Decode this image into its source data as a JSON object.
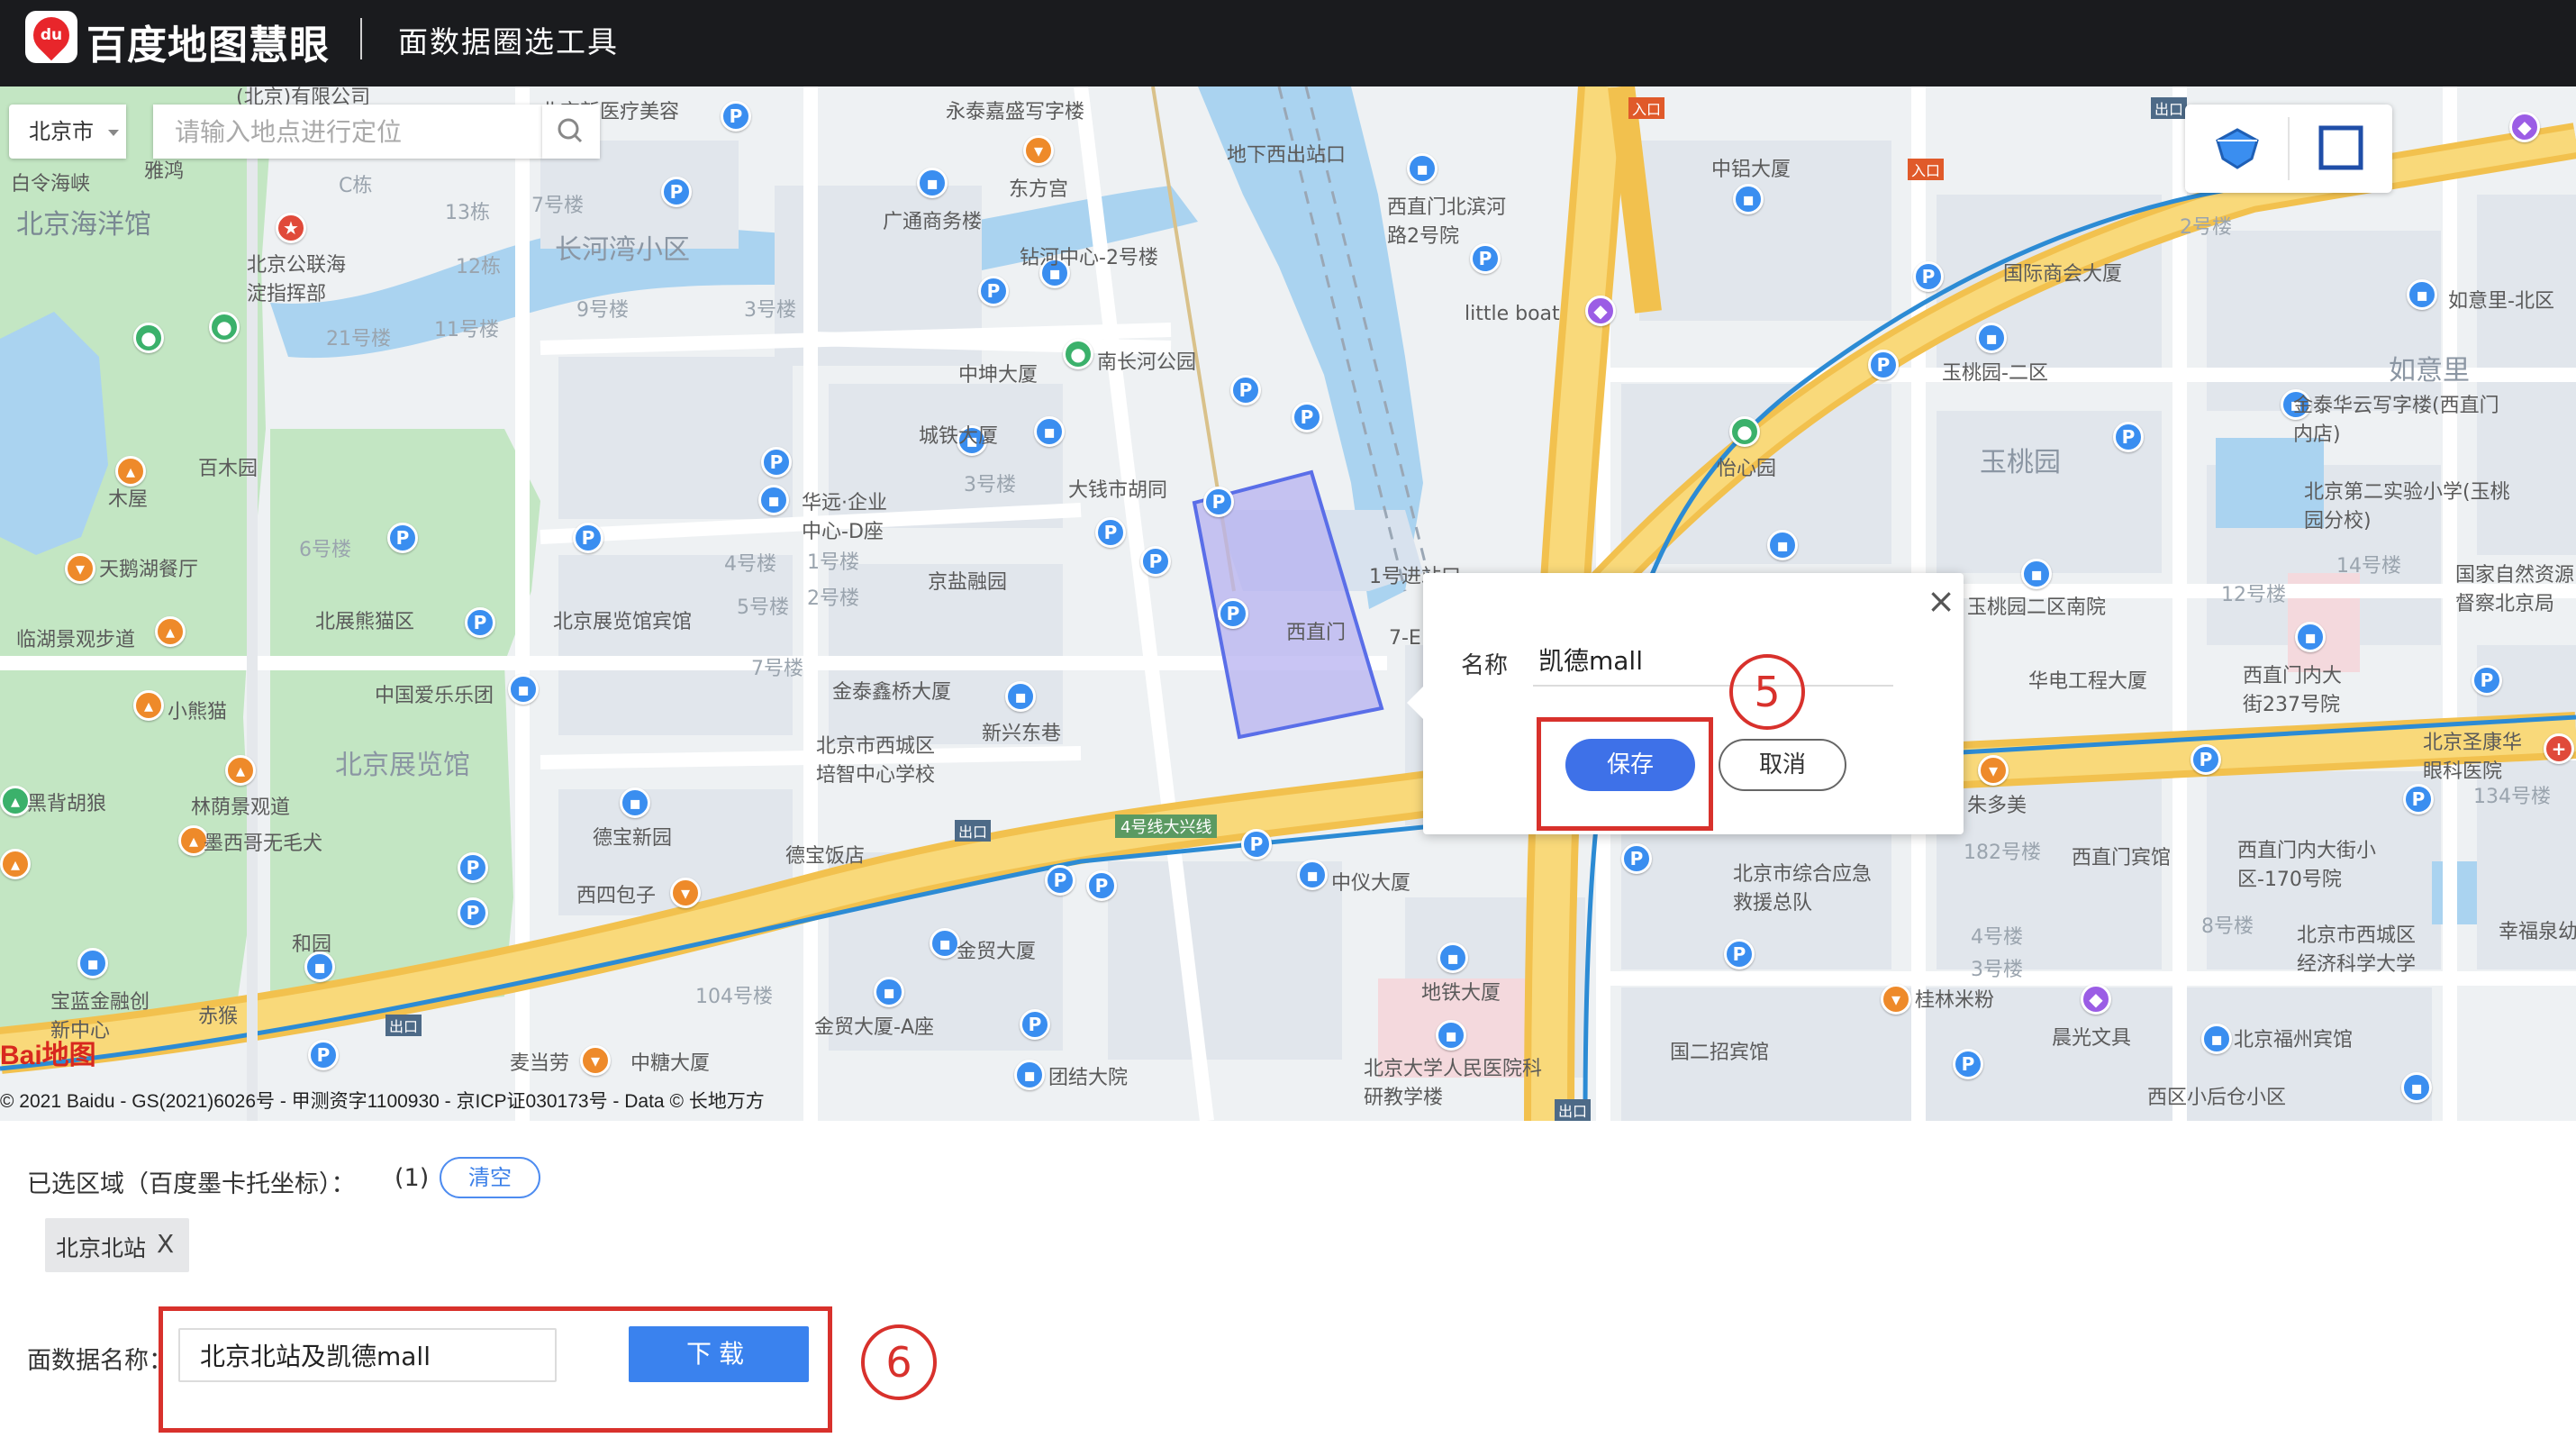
{
  "header": {
    "logo_text": "du",
    "brand": "百度地图慧眼",
    "tool_title": "面数据圈选工具",
    "bg_color": "#1a1b1e"
  },
  "map": {
    "city_select": "北京市",
    "search_placeholder": "请输入地点进行定位",
    "attribution": "© 2021 Baidu - GS(2021)6026号 - 甲测资字1100930 - 京ICP证030173号 - Data © 长地万方",
    "baidu_logo": "Bai地图",
    "labels": {
      "a1": "(北京)有限公司",
      "a2": "北京新医疗美容",
      "a3": "永泰嘉盛写字楼",
      "a4": "地下西出站口",
      "a5": "西直门北滨河路2号院",
      "a6": "中铝大厦",
      "a7": "白令海峡",
      "a8": "雅鸿",
      "a9": "北京海洋馆",
      "a10": "C栋",
      "a11": "13栋",
      "a12": "7号楼",
      "a13": "广通商务楼",
      "a14": "东方宫",
      "a15": "长河湾小区",
      "a16": "钻河中心-2号楼",
      "a17": "北京公联海淀指挥部",
      "a18": "12栋",
      "a19": "9号楼",
      "a20": "3号楼",
      "a21": "21号楼",
      "a22": "11号楼",
      "a23": "中坤大厦",
      "a24": "南长河公园",
      "a25": "little boat",
      "a26": "国际商会大厦",
      "a27": "如意里-北区",
      "a28": "2号楼",
      "a29": "玉桃园-二区",
      "a30": "如意里",
      "a31": "百木园",
      "a32": "木屋",
      "a33": "城铁大厦",
      "a34": "3号楼",
      "a35": "大钱市胡同",
      "a36": "华远·企业中心-D座",
      "a37": "怡心园",
      "a38": "玉桃园",
      "a39": "金泰华云写字楼(西直门内店)",
      "a40": "北京第二实验小学(玉桃园分校)",
      "a41": "6号楼",
      "a42": "天鹅湖餐厅",
      "a43": "北展熊猫区",
      "a44": "北京展览馆宾馆",
      "a45": "4号楼",
      "a46": "1号楼",
      "a47": "2号楼",
      "a48": "京盐融园",
      "a49": "西直门",
      "a50": "1号进站口",
      "a51": "7-E",
      "a52": "玉桃园二区南院",
      "a53": "国家自然资源督察北京局",
      "a54": "临湖景观步道",
      "a55": "7号楼",
      "a56": "5号楼",
      "a57": "中国爱乐乐团",
      "a58": "小熊猫",
      "a59": "金泰鑫桥大厦",
      "a60": "新兴东巷",
      "a61": "华电工程大厦",
      "a62": "西直门内大街237号院",
      "a63": "12号楼",
      "a64": "14号楼",
      "a65": "北京展览馆",
      "a66": "北京市西城区培智中心学校",
      "a67": "黑背胡狼",
      "a68": "林荫景观道",
      "a69": "墨西哥无毛犬",
      "a70": "德宝新园",
      "a71": "德宝饭店",
      "a72": "4号线大兴线",
      "a73": "朱多美",
      "a74": "西直门宾馆",
      "a75": "西直门内大街小区-170号院",
      "a76": "北京圣康华眼科医院",
      "a77": "134号楼",
      "a78": "中仪大厦",
      "a79": "北京市综合应急救援总队",
      "a80": "和园",
      "a81": "西四包子",
      "a82": "金贸大厦",
      "a83": "地铁大厦",
      "a84": "宝蓝金融创新中心",
      "a85": "赤猴",
      "a86": "104号楼",
      "a87": "金贸大厦-A座",
      "a88": "桂林米粉",
      "a89": "晨光文具",
      "a90": "北京市西城区经济科学大学",
      "a91": "幸福泉幼",
      "a92": "北京大学人民医院科研教学楼",
      "a93": "国二招宾馆",
      "a94": "北京福州宾馆",
      "a95": "西区小后仓小区",
      "a96": "麦当劳",
      "a97": "中糖大厦",
      "a98": "团结大院",
      "a99": "8号楼",
      "a100": "4号楼",
      "a101": "3号楼",
      "a102": "182号楼",
      "a103": "出口",
      "a104": "入口"
    }
  },
  "popup": {
    "name_label": "名称",
    "name_value": "凯德mall",
    "save": "保存",
    "cancel": "取消",
    "close": "×"
  },
  "annotations": {
    "step5": "5",
    "step6": "6",
    "color": "#d8312c"
  },
  "panel": {
    "selected_label": "已选区域（百度墨卡托坐标）：",
    "selected_count": "(1)",
    "clear": "清空",
    "chip_label": "北京北站",
    "chip_remove": "X",
    "name_label": "面数据名称：",
    "name_value": "北京北站及凯德mall",
    "download": "下载",
    "accent_color": "#3a82ee"
  }
}
